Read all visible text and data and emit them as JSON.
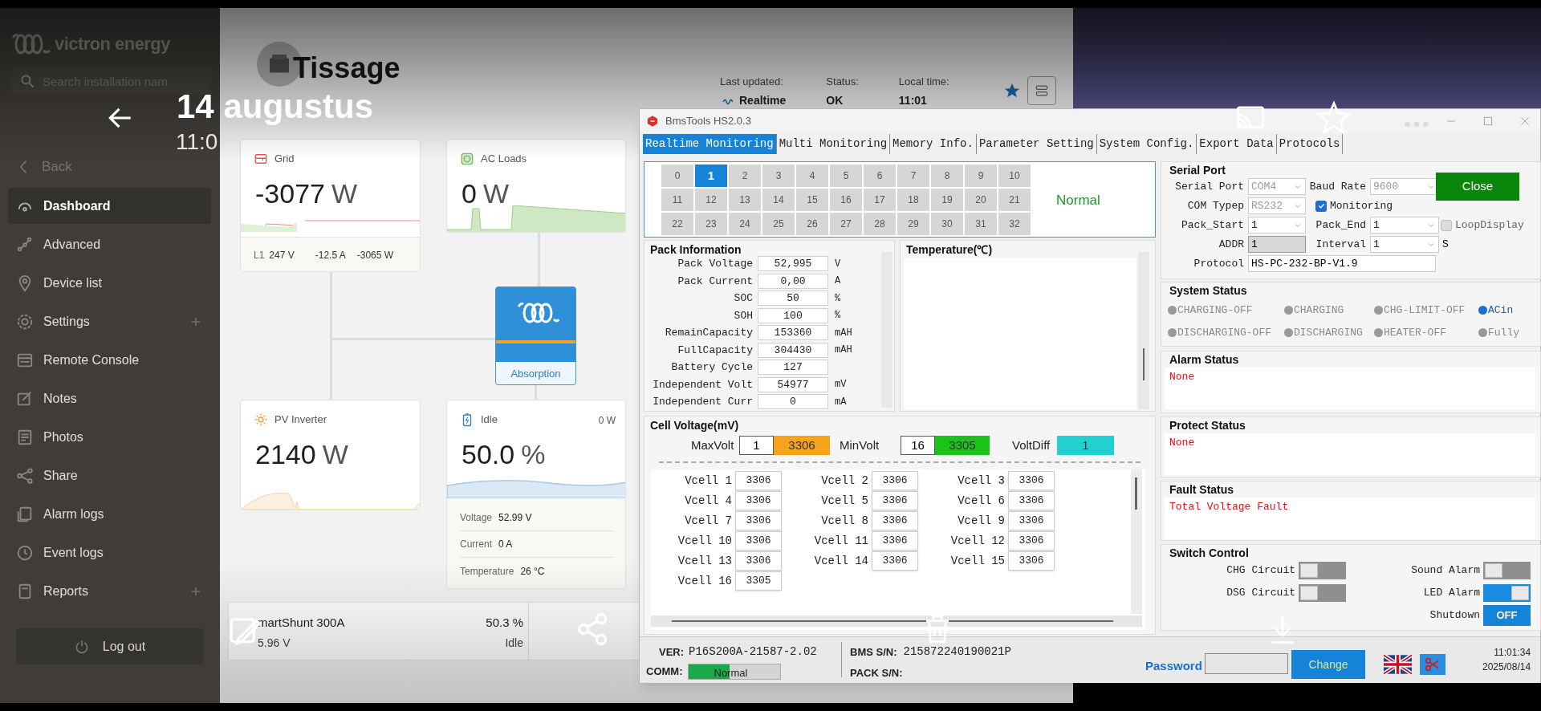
{
  "viewer": {
    "date": "14 augustus",
    "time": "11:0"
  },
  "sidebar": {
    "brand": "victron energy",
    "search_placeholder": "Search installation nam",
    "back": "Back",
    "logout": "Log out",
    "items": [
      {
        "label": "Dashboard",
        "selected": true,
        "expandable": false
      },
      {
        "label": "Advanced",
        "selected": false,
        "expandable": false
      },
      {
        "label": "Device list",
        "selected": false,
        "expandable": false
      },
      {
        "label": "Settings",
        "selected": false,
        "expandable": true
      },
      {
        "label": "Remote Console",
        "selected": false,
        "expandable": false
      },
      {
        "label": "Notes",
        "selected": false,
        "expandable": false
      },
      {
        "label": "Photos",
        "selected": false,
        "expandable": false
      },
      {
        "label": "Share",
        "selected": false,
        "expandable": false
      },
      {
        "label": "Alarm logs",
        "selected": false,
        "expandable": false
      },
      {
        "label": "Event logs",
        "selected": false,
        "expandable": false
      },
      {
        "label": "Reports",
        "selected": false,
        "expandable": true
      }
    ]
  },
  "header": {
    "title": "Tissage",
    "favorite": true,
    "fields": [
      {
        "label": "Last updated:",
        "value": "Realtime"
      },
      {
        "label": "Status:",
        "value": "OK"
      },
      {
        "label": "Local time:",
        "value": "11:01"
      }
    ]
  },
  "grid_card": {
    "title": "Grid",
    "value": "-3077",
    "unit": "W",
    "phase": "L1",
    "voltage": "247 V",
    "current": "-12.5 A",
    "power": "-3065 W"
  },
  "acloads_card": {
    "title": "AC Loads",
    "value": "0",
    "unit": "W"
  },
  "inverter": {
    "state": "Absorption"
  },
  "pv_card": {
    "title": "PV Inverter",
    "value": "2140",
    "unit": "W"
  },
  "battery_card": {
    "title": "Idle",
    "power": "0 W",
    "value": "50.0",
    "unit": "%",
    "details": [
      {
        "label": "Voltage",
        "value": "52.99 V"
      },
      {
        "label": "Current",
        "value": "0 A"
      },
      {
        "label": "Temperature",
        "value": "26 °C"
      }
    ]
  },
  "shunt": {
    "name": "martShunt 300A",
    "voltage": "5.96 V",
    "soc": "50.3 %",
    "state": "Idle"
  },
  "bms": {
    "title": "BmsTools HS2.0.3",
    "tabs": [
      {
        "label": "Realtime Monitoring",
        "selected": true
      },
      {
        "label": "Multi Monitoring",
        "selected": false
      },
      {
        "label": "Memory Info.",
        "selected": false
      },
      {
        "label": "Parameter Setting",
        "selected": false
      },
      {
        "label": "System Config.",
        "selected": false
      },
      {
        "label": "Export Data",
        "selected": false
      },
      {
        "label": "Protocols",
        "selected": false
      }
    ],
    "packs": [
      {
        "label": "0",
        "selected": false
      },
      {
        "label": "1",
        "selected": true
      },
      {
        "label": "2",
        "selected": false
      },
      {
        "label": "3",
        "selected": false
      },
      {
        "label": "4",
        "selected": false
      },
      {
        "label": "5",
        "selected": false
      },
      {
        "label": "6",
        "selected": false
      },
      {
        "label": "7",
        "selected": false
      },
      {
        "label": "8",
        "selected": false
      },
      {
        "label": "9",
        "selected": false
      },
      {
        "label": "10",
        "selected": false
      },
      {
        "label": "11",
        "selected": false
      },
      {
        "label": "12",
        "selected": false
      },
      {
        "label": "13",
        "selected": false
      },
      {
        "label": "14",
        "selected": false
      },
      {
        "label": "15",
        "selected": false
      },
      {
        "label": "16",
        "selected": false
      },
      {
        "label": "17",
        "selected": false
      },
      {
        "label": "18",
        "selected": false
      },
      {
        "label": "19",
        "selected": false
      },
      {
        "label": "20",
        "selected": false
      },
      {
        "label": "21",
        "selected": false
      },
      {
        "label": "22",
        "selected": false
      },
      {
        "label": "23",
        "selected": false
      },
      {
        "label": "24",
        "selected": false
      },
      {
        "label": "25",
        "selected": false
      },
      {
        "label": "26",
        "selected": false
      },
      {
        "label": "27",
        "selected": false
      },
      {
        "label": "28",
        "selected": false
      },
      {
        "label": "29",
        "selected": false
      },
      {
        "label": "30",
        "selected": false
      },
      {
        "label": "31",
        "selected": false
      },
      {
        "label": "32",
        "selected": false
      }
    ],
    "pack_status": "Normal",
    "pack_info": {
      "title": "Pack Information",
      "rows": [
        {
          "label": "Pack Voltage",
          "value": "52,995",
          "unit": "V"
        },
        {
          "label": "Pack Current",
          "value": "0,00",
          "unit": "A"
        },
        {
          "label": "SOC",
          "value": "50",
          "unit": "%"
        },
        {
          "label": "SOH",
          "value": "100",
          "unit": "%"
        },
        {
          "label": "RemainCapacity",
          "value": "153360",
          "unit": "mAH"
        },
        {
          "label": "FullCapacity",
          "value": "304430",
          "unit": "mAH"
        },
        {
          "label": "Battery Cycle",
          "value": "127"
        },
        {
          "label": "Independent Volt",
          "value": "54977",
          "unit": "mV"
        },
        {
          "label": "Independent Curr",
          "value": "0",
          "unit": "mA"
        }
      ]
    },
    "temperature": {
      "title": "Temperature(℃)"
    },
    "serial": {
      "title": "Serial Port",
      "port_label": "Serial Port",
      "port": "COM4",
      "baud_label": "Baud Rate",
      "baud": "9600",
      "close": "Close",
      "type_label": "COM Typep",
      "type": "RS232",
      "monitoring": {
        "label": "Monitoring",
        "checked": true
      },
      "start_label": "Pack_Start",
      "start": "1",
      "end_label": "Pack_End",
      "end": "1",
      "loop": {
        "label": "LoopDisplay",
        "checked": false
      },
      "addr_label": "ADDR",
      "addr": "1",
      "interval_label": "Interval",
      "interval": "1",
      "interval_unit": "S",
      "protocol_label": "Protocol",
      "protocol": "HS-PC-232-BP-V1.9"
    },
    "system_status": {
      "title": "System Status",
      "items": [
        {
          "label": "CHARGING-OFF",
          "on": false
        },
        {
          "label": "CHARGING",
          "on": false
        },
        {
          "label": "CHG-LIMIT-OFF",
          "on": false
        },
        {
          "label": "ACin",
          "on": true
        },
        {
          "label": "DISCHARGING-OFF",
          "on": false
        },
        {
          "label": "DISCHARGING",
          "on": false
        },
        {
          "label": "HEATER-OFF",
          "on": false
        },
        {
          "label": "Fully",
          "on": false
        }
      ]
    },
    "alarm": {
      "title": "Alarm Status",
      "text": "None"
    },
    "protect": {
      "title": "Protect Status",
      "text": "None"
    },
    "fault": {
      "title": "Fault Status",
      "text": "Total Voltage Fault"
    },
    "switches": {
      "title": "Switch Control",
      "items": [
        {
          "label": "CHG Circuit",
          "kind": "toggle",
          "on": false
        },
        {
          "label": "Sound Alarm",
          "kind": "toggle",
          "on": false
        },
        {
          "label": "DSG Circuit",
          "kind": "toggle",
          "on": false
        },
        {
          "label": "LED Alarm",
          "kind": "toggle",
          "on": true
        },
        {
          "label": "Shutdown",
          "kind": "button",
          "value": "OFF"
        }
      ]
    },
    "cells": {
      "title": "Cell Voltage(mV)",
      "max_label": "MaxVolt",
      "max_cell": "1",
      "max_value": "3306",
      "min_label": "MinVolt",
      "min_cell": "16",
      "min_value": "3305",
      "diff_label": "VoltDiff",
      "diff": "1",
      "items": [
        {
          "label": "Vcell 1",
          "value": "3306"
        },
        {
          "label": "Vcell 2",
          "value": "3306"
        },
        {
          "label": "Vcell 3",
          "value": "3306"
        },
        {
          "label": "Vcell 4",
          "value": "3306"
        },
        {
          "label": "Vcell 5",
          "value": "3306"
        },
        {
          "label": "Vcell 6",
          "value": "3306"
        },
        {
          "label": "Vcell 7",
          "value": "3306"
        },
        {
          "label": "Vcell 8",
          "value": "3306"
        },
        {
          "label": "Vcell 9",
          "value": "3306"
        },
        {
          "label": "Vcell 10",
          "value": "3306"
        },
        {
          "label": "Vcell 11",
          "value": "3306"
        },
        {
          "label": "Vcell 12",
          "value": "3306"
        },
        {
          "label": "Vcell 13",
          "value": "3306"
        },
        {
          "label": "Vcell 14",
          "value": "3306"
        },
        {
          "label": "Vcell 15",
          "value": "3306"
        },
        {
          "label": "Vcell 16",
          "value": "3305"
        }
      ]
    },
    "footer": {
      "ver_label": "VER:",
      "ver": "P16S200A-21587-2.02",
      "sn_label": "BMS S/N:",
      "sn": "215872240190021P",
      "comm_label": "COMM:",
      "comm": "Normal",
      "comm_level": {
        "level": 0.45
      },
      "pack_sn_label": "PACK S/N:",
      "password_label": "Password",
      "change": "Change",
      "time": "11:01:34",
      "date": "2025/08/14"
    }
  }
}
